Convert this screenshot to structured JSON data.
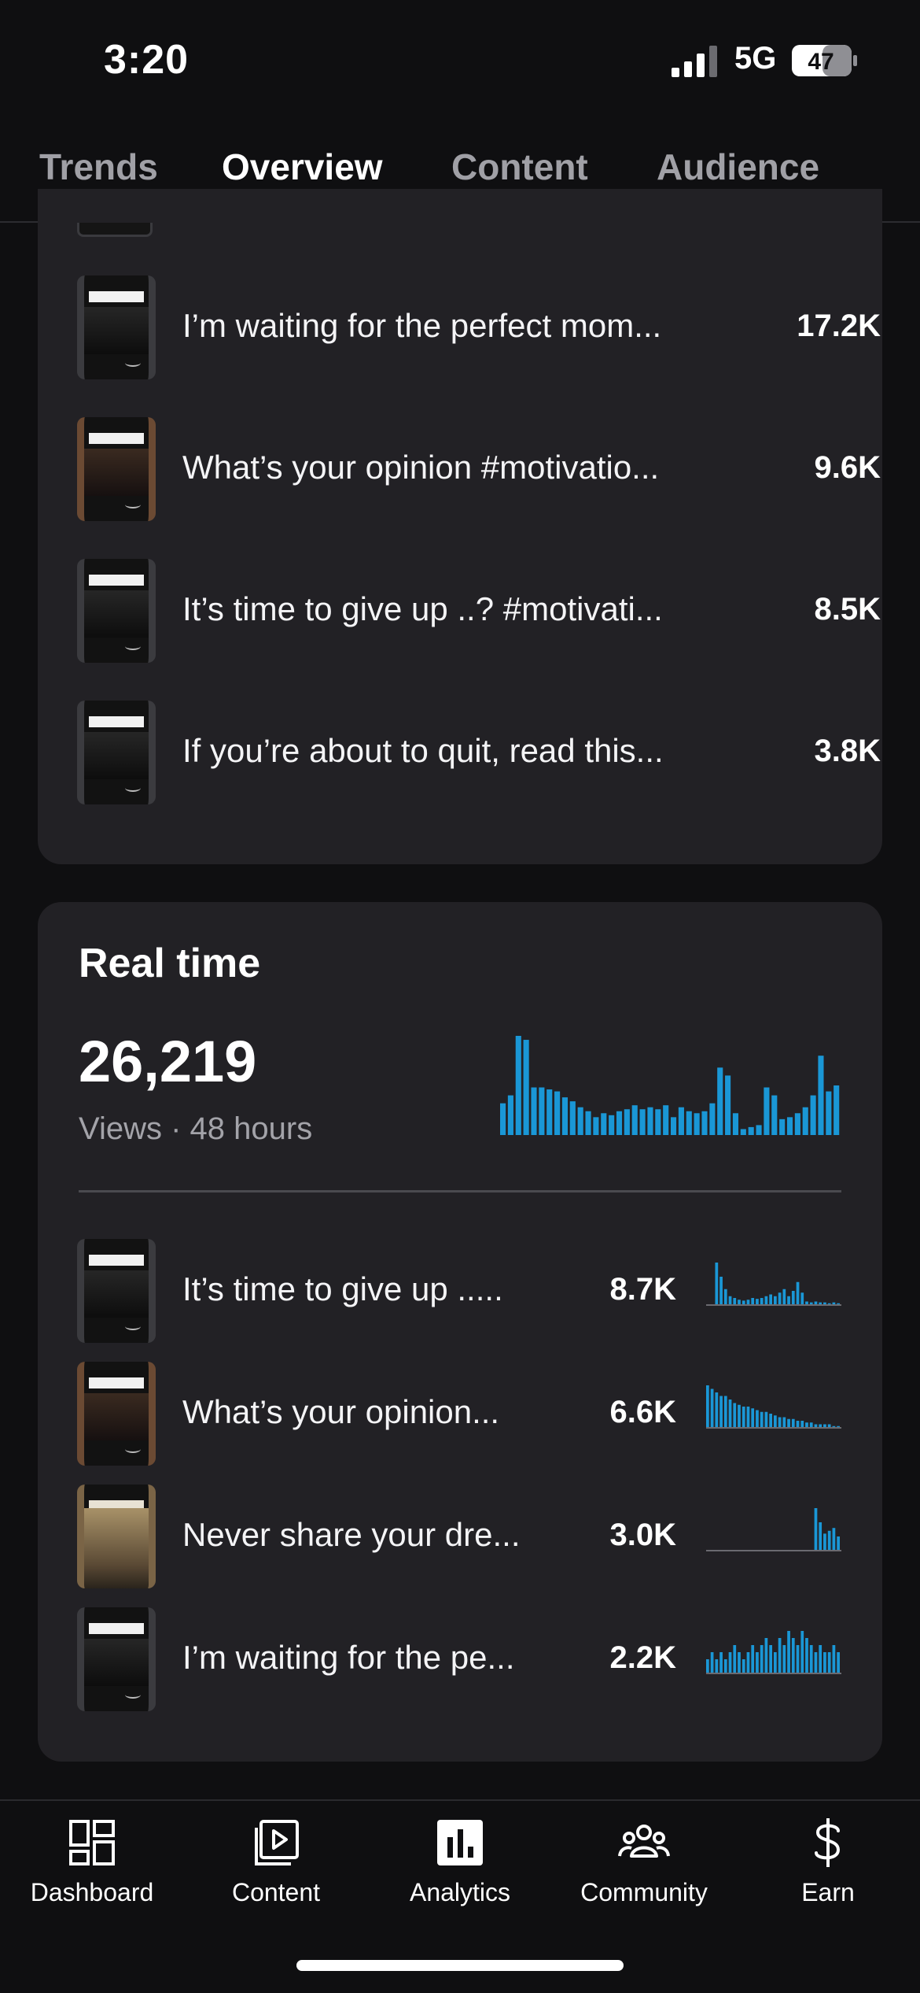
{
  "status_bar": {
    "time": "3:20",
    "network": "5G",
    "battery": "47"
  },
  "tabs": [
    {
      "label": "Trends"
    },
    {
      "label": "Overview"
    },
    {
      "label": "Content"
    },
    {
      "label": "Audience"
    }
  ],
  "active_tab": "Overview",
  "top_content": {
    "items": [
      {
        "title": "I’m waiting for the perfect mom...",
        "value": "17.2K"
      },
      {
        "title": "What’s your opinion #motivatio...",
        "value": "9.6K"
      },
      {
        "title": "It’s time to give up ..? #motivati...",
        "value": "8.5K"
      },
      {
        "title": "If you’re about to quit, read this...",
        "value": "3.8K"
      }
    ]
  },
  "realtime": {
    "heading": "Real time",
    "views": "26,219",
    "subtitle": "Views · 48 hours",
    "items": [
      {
        "title": "It’s time to give up .....",
        "value": "8.7K"
      },
      {
        "title": "What’s your opinion...",
        "value": "6.6K"
      },
      {
        "title": "Never share your dre...",
        "value": "3.0K"
      },
      {
        "title": "I’m waiting for the pe...",
        "value": "2.2K"
      }
    ]
  },
  "chart_data": {
    "type": "bar",
    "title": "",
    "xlabel": "",
    "ylabel": "",
    "values": [
      16,
      20,
      50,
      48,
      24,
      24,
      23,
      22,
      19,
      17,
      14,
      12,
      9,
      11,
      10,
      12,
      13,
      15,
      13,
      14,
      13,
      15,
      9,
      14,
      12,
      11,
      12,
      16,
      34,
      30,
      11,
      3,
      4,
      5,
      24,
      20,
      8,
      9,
      11,
      14,
      20,
      40,
      22,
      25
    ],
    "color": "#1a97d6",
    "grid": false,
    "legend": "none"
  },
  "sparklines": [
    {
      "color": "#1a97d6",
      "values": [
        0,
        0,
        48,
        32,
        18,
        10,
        8,
        6,
        5,
        6,
        8,
        7,
        8,
        10,
        12,
        10,
        14,
        18,
        10,
        16,
        26,
        14,
        4,
        3,
        4,
        3,
        3,
        2,
        3,
        2
      ]
    },
    {
      "color": "#1a97d6",
      "values": [
        24,
        22,
        20,
        18,
        18,
        16,
        14,
        13,
        12,
        12,
        11,
        10,
        9,
        9,
        8,
        7,
        6,
        6,
        5,
        5,
        4,
        4,
        3,
        3,
        2,
        2,
        2,
        2,
        1,
        1
      ]
    },
    {
      "color": "#1a97d6",
      "values": [
        0,
        0,
        0,
        0,
        0,
        0,
        0,
        0,
        0,
        0,
        0,
        0,
        0,
        0,
        0,
        0,
        0,
        0,
        0,
        0,
        0,
        0,
        0,
        0,
        30,
        20,
        12,
        14,
        16,
        10
      ]
    },
    {
      "color": "#1a97d6",
      "values": [
        2,
        3,
        2,
        3,
        2,
        3,
        4,
        3,
        2,
        3,
        4,
        3,
        4,
        5,
        4,
        3,
        5,
        4,
        6,
        5,
        4,
        6,
        5,
        4,
        3,
        4,
        3,
        3,
        4,
        3
      ]
    }
  ],
  "bottom_nav": [
    {
      "label": "Dashboard",
      "icon": "dashboard-icon"
    },
    {
      "label": "Content",
      "icon": "content-play-icon"
    },
    {
      "label": "Analytics",
      "icon": "analytics-icon"
    },
    {
      "label": "Community",
      "icon": "community-icon"
    },
    {
      "label": "Earn",
      "icon": "earn-dollar-icon"
    }
  ]
}
